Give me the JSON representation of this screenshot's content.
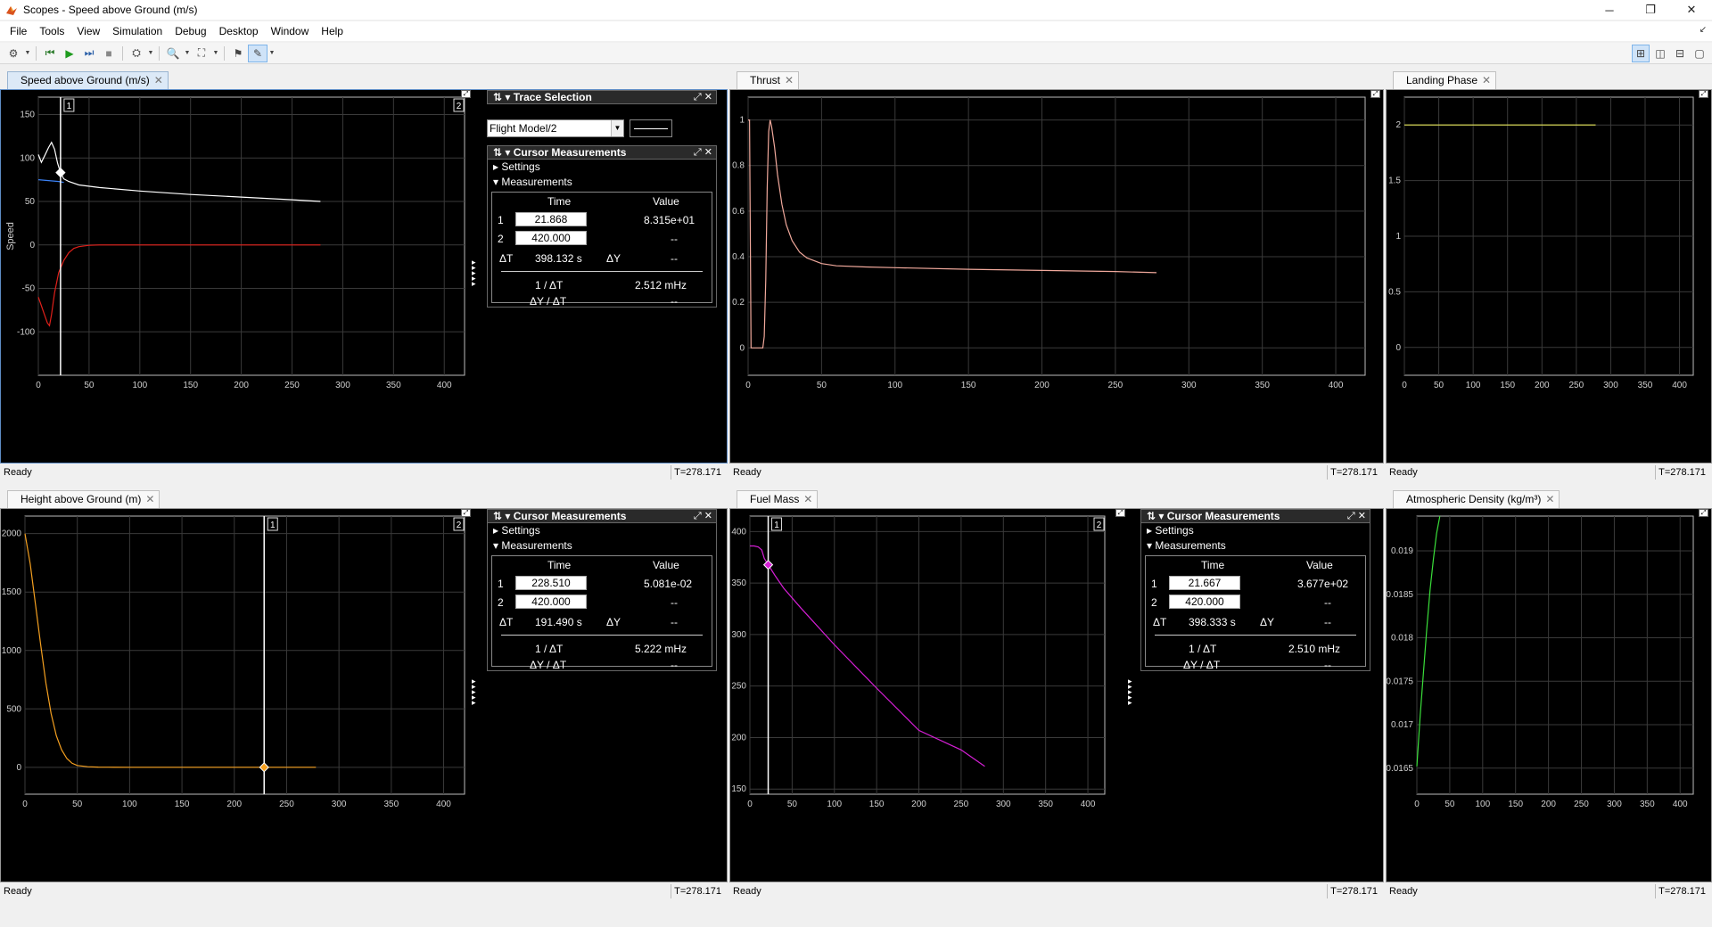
{
  "window": {
    "title": "Scopes - Speed above Ground (m/s)",
    "minimize": "─",
    "restore": "❐",
    "close": "✕"
  },
  "menu": [
    "File",
    "Tools",
    "View",
    "Simulation",
    "Debug",
    "Desktop",
    "Window",
    "Help"
  ],
  "status_ready": "Ready",
  "sim_time": "T=278.171",
  "panels": {
    "speed": {
      "tab": "Speed above Ground (m/s)",
      "ylabel": "Speed"
    },
    "thrust": {
      "tab": "Thrust"
    },
    "landing": {
      "tab": "Landing Phase"
    },
    "height": {
      "tab": "Height above Ground (m)"
    },
    "fuel": {
      "tab": "Fuel Mass"
    },
    "density": {
      "tab": "Atmospheric Density (kg/m³)"
    }
  },
  "trace_selection": {
    "title": "Trace Selection",
    "selected": "Flight Model/2"
  },
  "measurements": {
    "title": "Cursor Measurements",
    "settings": "Settings",
    "section": "Measurements",
    "col_time": "Time",
    "col_value": "Value",
    "dt_label": "ΔT",
    "dy_label": "ΔY",
    "inv_dt_label": "1 / ΔT",
    "dydt_label": "ΔY / ΔT",
    "row1_label": "1",
    "row2_label": "2",
    "placeholder": "--",
    "speed": {
      "t1": "21.868",
      "v1": "8.315e+01",
      "t2": "420.000",
      "dt": "398.132 s",
      "inv": "2.512 mHz"
    },
    "height": {
      "t1": "228.510",
      "v1": "5.081e-02",
      "t2": "420.000",
      "dt": "191.490 s",
      "inv": "5.222 mHz"
    },
    "fuel": {
      "t1": "21.667",
      "v1": "3.677e+02",
      "t2": "420.000",
      "dt": "398.333 s",
      "inv": "2.510 mHz"
    }
  },
  "cursor_labels": [
    "1",
    "2"
  ],
  "chart_data": [
    {
      "id": "speed",
      "type": "line",
      "title": "Speed above Ground (m/s)",
      "ylabel": "Speed",
      "xlabel": "",
      "xlim": [
        0,
        420
      ],
      "ylim": [
        -150,
        170
      ],
      "grid": true,
      "xticks": [
        0,
        50,
        100,
        150,
        200,
        250,
        300,
        350,
        400
      ],
      "yticks": [
        -100,
        -50,
        0,
        50,
        100,
        150
      ],
      "cursors": [
        21.868,
        420
      ],
      "marker": [
        21.868,
        83.15
      ],
      "series": [
        {
          "color": "#ffffff",
          "x": [
            0,
            3,
            6,
            10,
            13,
            16,
            19,
            21.9,
            25,
            30,
            40,
            60,
            100,
            150,
            200,
            250,
            278
          ],
          "y": [
            104,
            95,
            102,
            112,
            118,
            110,
            94,
            83,
            76,
            73,
            69,
            66,
            62,
            58,
            55,
            52,
            50
          ]
        },
        {
          "color": "#3b82f6",
          "x": [
            0,
            5,
            10,
            15,
            20,
            25
          ],
          "y": [
            75,
            74.5,
            74,
            73.5,
            73,
            72
          ]
        },
        {
          "color": "#e0201a",
          "x": [
            0,
            3,
            6,
            9,
            11,
            13,
            16,
            20,
            25,
            30,
            35,
            40,
            50,
            60,
            100,
            150,
            200,
            250,
            278
          ],
          "y": [
            -60,
            -70,
            -80,
            -90,
            -93,
            -80,
            -55,
            -32,
            -18,
            -9,
            -4,
            -2,
            -0.5,
            0,
            0,
            0,
            0,
            0,
            0
          ]
        }
      ]
    },
    {
      "id": "thrust",
      "type": "line",
      "title": "Thrust",
      "xlim": [
        0,
        420
      ],
      "ylim": [
        -0.12,
        1.1
      ],
      "grid": true,
      "xticks": [
        0,
        50,
        100,
        150,
        200,
        250,
        300,
        350,
        400
      ],
      "yticks": [
        0,
        0.2,
        0.4,
        0.6,
        0.8,
        1
      ],
      "series": [
        {
          "color": "#f1a99c",
          "x": [
            0,
            1,
            2,
            2.5,
            3,
            4,
            8,
            10,
            11,
            12,
            13,
            14,
            15,
            16,
            18,
            20,
            23,
            26,
            30,
            35,
            40,
            50,
            60,
            80,
            100,
            150,
            200,
            250,
            278
          ],
          "y": [
            1,
            1,
            0,
            0,
            0,
            0,
            0,
            0,
            0.05,
            0.3,
            0.7,
            0.95,
            1,
            0.97,
            0.88,
            0.76,
            0.63,
            0.54,
            0.47,
            0.42,
            0.395,
            0.37,
            0.36,
            0.355,
            0.352,
            0.345,
            0.34,
            0.335,
            0.33
          ]
        }
      ]
    },
    {
      "id": "landing",
      "type": "line",
      "title": "Landing Phase",
      "xlim": [
        0,
        420
      ],
      "ylim": [
        -0.25,
        2.25
      ],
      "grid": true,
      "xticks": [
        0,
        50,
        100,
        150,
        200,
        250,
        300,
        350,
        400
      ],
      "yticks": [
        0,
        0.5,
        1,
        1.5,
        2
      ],
      "series": [
        {
          "color": "#e8e85a",
          "x": [
            0,
            278
          ],
          "y": [
            2,
            2
          ]
        }
      ]
    },
    {
      "id": "height",
      "type": "line",
      "title": "Height above Ground (m)",
      "xlim": [
        0,
        420
      ],
      "ylim": [
        -230,
        2150
      ],
      "grid": true,
      "xticks": [
        0,
        50,
        100,
        150,
        200,
        250,
        300,
        350,
        400
      ],
      "yticks": [
        0,
        500,
        1000,
        1500,
        2000
      ],
      "cursors": [
        228.51,
        420
      ],
      "marker": [
        228.51,
        0.05
      ],
      "series": [
        {
          "color": "#f5a020",
          "x": [
            0,
            5,
            10,
            15,
            20,
            25,
            30,
            35,
            40,
            45,
            50,
            60,
            70,
            80,
            100,
            150,
            200,
            250,
            278
          ],
          "y": [
            2000,
            1740,
            1400,
            1050,
            720,
            460,
            270,
            150,
            75,
            35,
            16,
            5,
            2,
            1,
            0,
            0,
            0,
            0,
            0
          ]
        }
      ]
    },
    {
      "id": "fuel",
      "type": "line",
      "title": "Fuel Mass",
      "xlim": [
        0,
        420
      ],
      "ylim": [
        145,
        415
      ],
      "grid": true,
      "xticks": [
        0,
        50,
        100,
        150,
        200,
        250,
        300,
        350,
        400
      ],
      "yticks": [
        150,
        200,
        250,
        300,
        350,
        400
      ],
      "cursors": [
        21.667,
        420
      ],
      "marker": [
        21.667,
        367.7
      ],
      "series": [
        {
          "color": "#d61fd6",
          "x": [
            0,
            5,
            10,
            14,
            17,
            21.7,
            30,
            40,
            60,
            100,
            150,
            200,
            250,
            278
          ],
          "y": [
            386,
            386,
            385,
            382,
            374,
            367.7,
            357,
            345,
            326,
            290,
            248,
            207,
            188,
            172
          ]
        }
      ]
    },
    {
      "id": "density",
      "type": "line",
      "title": "Atmospheric Density (kg/m³)",
      "xlim": [
        0,
        420
      ],
      "ylim": [
        0.0162,
        0.0194
      ],
      "grid": true,
      "xticks": [
        0,
        50,
        100,
        150,
        200,
        250,
        300,
        350,
        400
      ],
      "yticks": [
        0.0165,
        0.017,
        0.0175,
        0.018,
        0.0185,
        0.019
      ],
      "series": [
        {
          "color": "#3adf3a",
          "x": [
            0,
            5,
            10,
            15,
            20,
            25,
            30,
            35
          ],
          "y": [
            0.01652,
            0.0171,
            0.0176,
            0.0181,
            0.01855,
            0.0189,
            0.0192,
            0.0194
          ]
        }
      ]
    }
  ]
}
